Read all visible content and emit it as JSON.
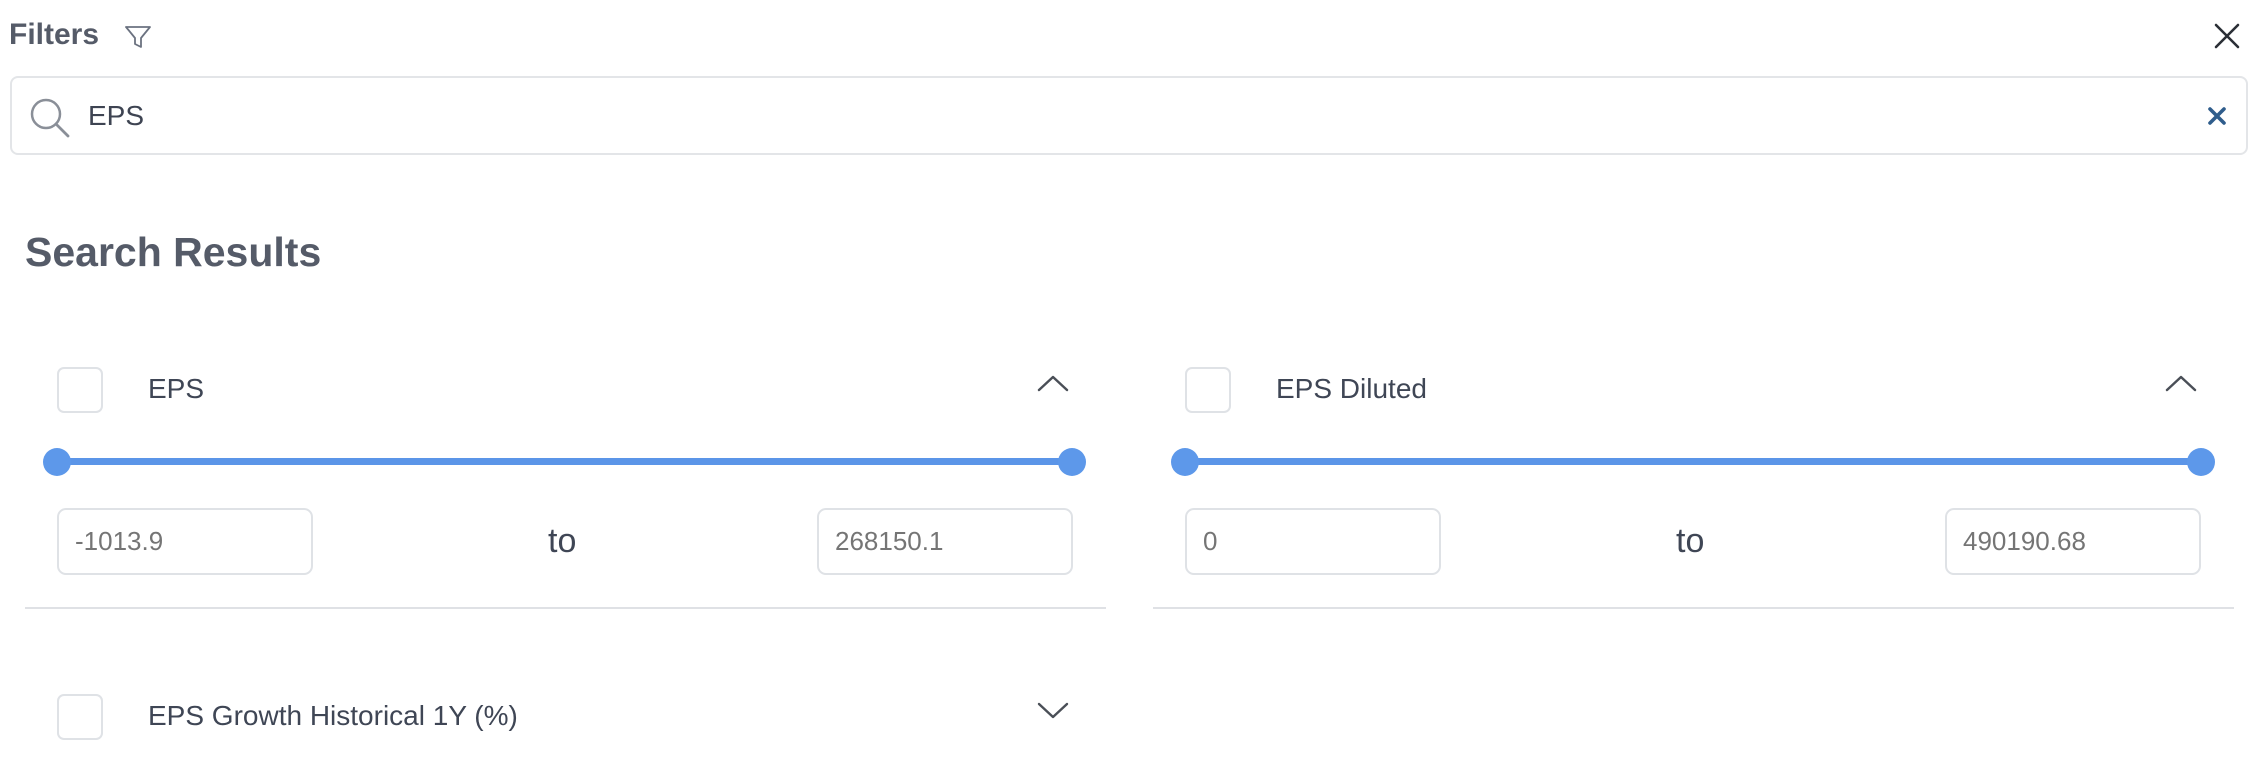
{
  "header": {
    "title": "Filters",
    "filter_icon": "filter-funnel-icon",
    "close_icon": "close-x-icon"
  },
  "search": {
    "value": "EPS",
    "search_icon": "magnifier-icon",
    "clear_icon": "clear-x-icon",
    "accent": "#2f5d8c"
  },
  "results": {
    "title": "Search Results",
    "to_label": "to",
    "accent": "#5b95e8",
    "filters": [
      {
        "label": "EPS",
        "expanded": true,
        "chevron_icon": "chevron-up-icon",
        "min_value": "-1013.9",
        "max_value": "268150.1",
        "range_low_fraction": 0,
        "range_high_fraction": 1
      },
      {
        "label": "EPS Diluted",
        "expanded": true,
        "chevron_icon": "chevron-up-icon",
        "min_value": "0",
        "max_value": "490190.68",
        "range_low_fraction": 0,
        "range_high_fraction": 1
      },
      {
        "label": "EPS Growth Historical 1Y (%)",
        "expanded": false,
        "chevron_icon": "chevron-down-icon"
      }
    ]
  }
}
